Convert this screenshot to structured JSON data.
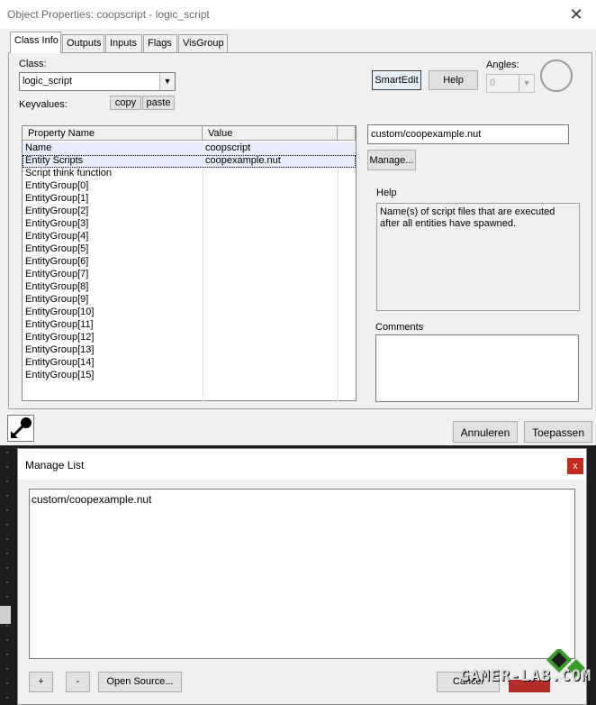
{
  "window": {
    "title": "Object Properties: coopscript - logic_script",
    "close_label": "✕"
  },
  "tabs": [
    {
      "label": "Class Info"
    },
    {
      "label": "Outputs"
    },
    {
      "label": "Inputs"
    },
    {
      "label": "Flags"
    },
    {
      "label": "VisGroup"
    }
  ],
  "class_info": {
    "class_label": "Class:",
    "class_value": "logic_script",
    "keyvalues_label": "Keyvalues:",
    "copy_label": "copy",
    "paste_label": "paste",
    "smartedit_label": "SmartEdit",
    "help_button_label": "Help",
    "angles_label": "Angles:",
    "angles_value": "0"
  },
  "kv_table": {
    "columns": [
      "Property Name",
      "Value"
    ],
    "rows": [
      {
        "name": "Name",
        "value": "coopscript"
      },
      {
        "name": "Entity Scripts",
        "value": "coopexample.nut"
      },
      {
        "name": "Script think function",
        "value": ""
      },
      {
        "name": "EntityGroup[0]",
        "value": ""
      },
      {
        "name": "EntityGroup[1]",
        "value": ""
      },
      {
        "name": "EntityGroup[2]",
        "value": ""
      },
      {
        "name": "EntityGroup[3]",
        "value": ""
      },
      {
        "name": "EntityGroup[4]",
        "value": ""
      },
      {
        "name": "EntityGroup[5]",
        "value": ""
      },
      {
        "name": "EntityGroup[6]",
        "value": ""
      },
      {
        "name": "EntityGroup[7]",
        "value": ""
      },
      {
        "name": "EntityGroup[8]",
        "value": ""
      },
      {
        "name": "EntityGroup[9]",
        "value": ""
      },
      {
        "name": "EntityGroup[10]",
        "value": ""
      },
      {
        "name": "EntityGroup[11]",
        "value": ""
      },
      {
        "name": "EntityGroup[12]",
        "value": ""
      },
      {
        "name": "EntityGroup[13]",
        "value": ""
      },
      {
        "name": "EntityGroup[14]",
        "value": ""
      },
      {
        "name": "EntityGroup[15]",
        "value": ""
      }
    ]
  },
  "value_editor": {
    "value": "custom/coopexample.nut",
    "manage_label": "Manage..."
  },
  "help_panel": {
    "label": "Help",
    "text": "Name(s) of script files that are executed after all entities have spawned."
  },
  "comments_panel": {
    "label": "Comments",
    "text": ""
  },
  "footer": {
    "cancel_label": "Annuleren",
    "apply_label": "Toepassen"
  },
  "manage_dialog": {
    "title": "Manage List",
    "close_label": "x",
    "items": [
      "custom/coopexample.nut"
    ],
    "add_label": "+",
    "remove_label": "-",
    "open_source_label": "Open Source...",
    "cancel_label": "Cancel"
  },
  "watermark": {
    "text": "GAMER-LAB.COM"
  },
  "colors": {
    "dialog_bg": "#f0f0f0",
    "close_red": "#c42b1c",
    "selection": "#e8ecf9",
    "watermark_green": "#3a9a2a"
  },
  "icons": {
    "title_close": "close-icon",
    "eyedropper": "eyedropper-icon",
    "angle_dial": "angle-dial-icon",
    "dropdown": "chevron-down-icon"
  }
}
